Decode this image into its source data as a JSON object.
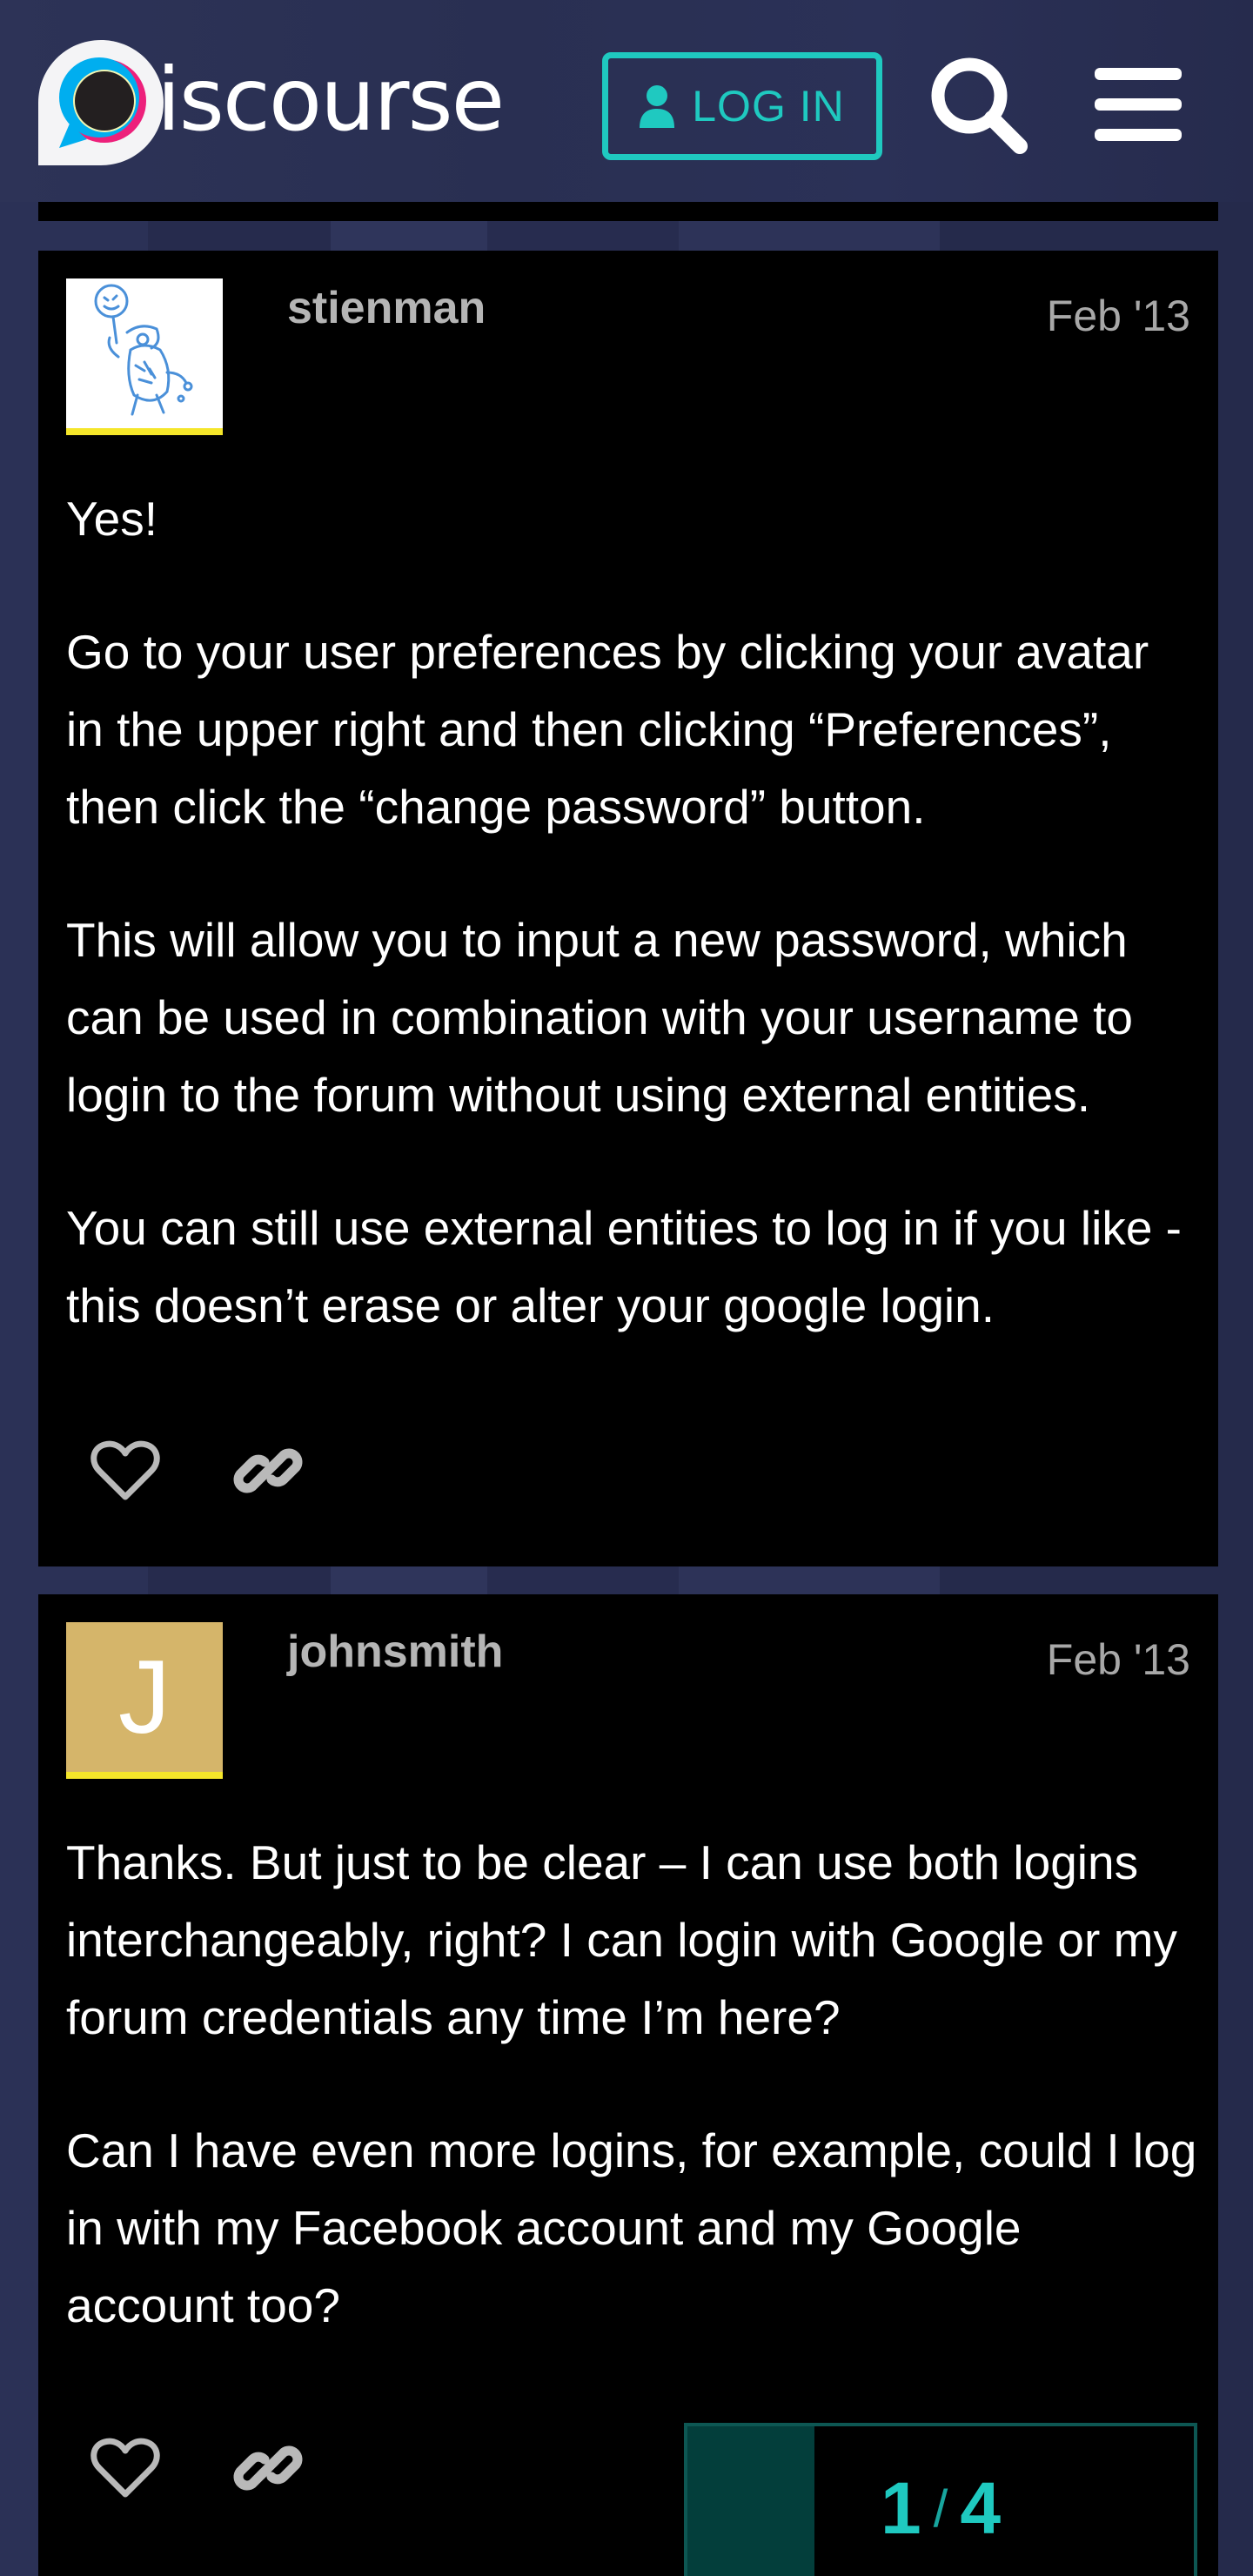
{
  "header": {
    "logo_text": "iscourse",
    "login_label": "LOG IN",
    "icons": {
      "user": "user-icon",
      "search": "search-icon",
      "menu": "hamburger-icon"
    },
    "colors": {
      "accent": "#1fc9c0",
      "logo_blue": "#00aeef",
      "logo_red": "#ed207b",
      "logo_yellow": "#fff9ae"
    }
  },
  "posts": [
    {
      "username": "stienman",
      "date": "Feb '13",
      "avatar_type": "image",
      "paragraphs": [
        "Yes!",
        "Go to your user preferences by clicking your avatar in the upper right and then clicking “Preferences”, then click the “change password” button.",
        "This will allow you to input a new password, which can be used in combination with your username to login to the forum without using external entities.",
        "You can still use external entities to log in if you like - this doesn’t erase or alter your google login."
      ]
    },
    {
      "username": "johnsmith",
      "date": "Feb '13",
      "avatar_type": "letter",
      "avatar_letter": "J",
      "avatar_color": "#d5b56a",
      "paragraphs": [
        "Thanks. But just to be clear – I can use both logins interchangeably, right? I can login with Google or my forum credentials any time I’m here?",
        "Can I have even more logins, for example, could I log in with my Facebook account and my Google account too?"
      ]
    }
  ],
  "post_actions": {
    "like_icon": "heart-icon",
    "link_icon": "link-icon"
  },
  "progress": {
    "current": "1",
    "separator": "/",
    "total": "4",
    "fill_fraction": 0.25
  }
}
